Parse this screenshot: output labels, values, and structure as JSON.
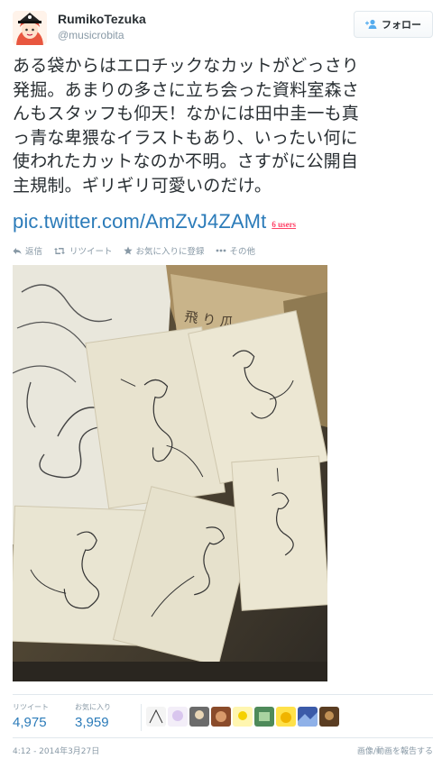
{
  "user": {
    "name": "RumikoTezuka",
    "handle": "@musicrobita",
    "follow_label": "フォロー"
  },
  "tweet": {
    "lines": [
      "ある袋からはエロチックなカットがどっさり",
      "発掘。あまりの多さに立ち会った資料室森さ",
      "んもスタッフも仰天！なかには田中圭一も真",
      "っ青な卑猥なイラストもあり、いったい何に",
      "使われたカットなのか不明。さすがに公開自",
      "主規制。ギリギリ可愛いのだけ。"
    ],
    "link": "pic.twitter.com/AmZvJ4ZAMt",
    "users_badge": "6 users"
  },
  "actions": {
    "reply": "返信",
    "retweet": "リツイート",
    "favorite": "お気に入りに登録",
    "more": "その他"
  },
  "stats": {
    "retweets_label": "リツイート",
    "retweets_value": "4,975",
    "favorites_label": "お気に入り",
    "favorites_value": "3,959"
  },
  "footer": {
    "timestamp": "4:12 - 2014年3月27日",
    "report": "画像/動画を報告する"
  },
  "colors": {
    "link": "#2b7bb9",
    "muted": "#8899a6",
    "text": "#292f33",
    "badge": "#ff4166"
  }
}
